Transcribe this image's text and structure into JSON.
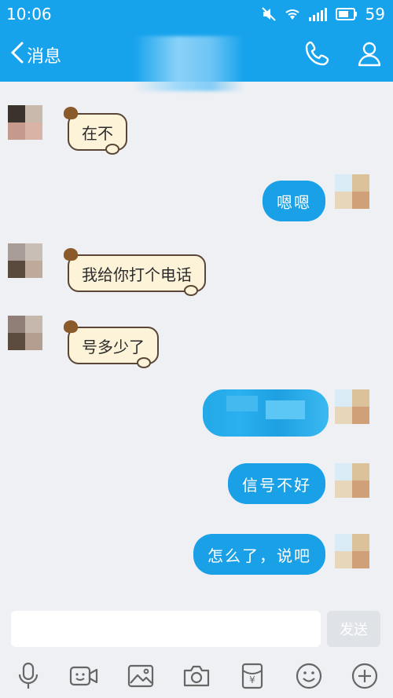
{
  "status_bar": {
    "time": "10:06",
    "battery": "59"
  },
  "header": {
    "back_label": "消息"
  },
  "messages": [
    {
      "side": "left",
      "text": "在不"
    },
    {
      "side": "right",
      "text": "嗯嗯"
    },
    {
      "side": "left",
      "text": "我给你打个电话"
    },
    {
      "side": "left",
      "text": "号多少了"
    },
    {
      "side": "right",
      "text": ""
    },
    {
      "side": "right",
      "text": "信号不好"
    },
    {
      "side": "right",
      "text": "怎么了，说吧"
    }
  ],
  "input": {
    "value": "",
    "send_label": "发送"
  },
  "toolbar": {
    "items": [
      "microphone-icon",
      "video-icon",
      "image-icon",
      "camera-icon",
      "red-packet-icon",
      "emoji-icon",
      "plus-icon"
    ]
  },
  "colors": {
    "accent": "#16a3ec",
    "right_bubble": "#1aa0e6",
    "left_bubble": "#fcf3d9",
    "background": "#eef0f4"
  }
}
